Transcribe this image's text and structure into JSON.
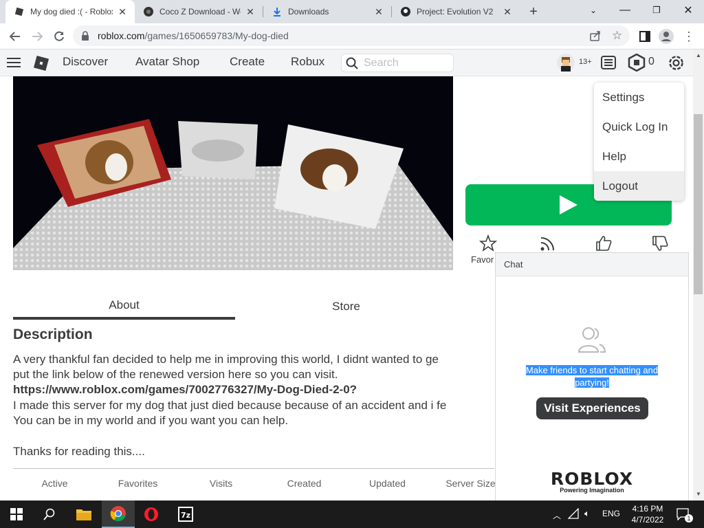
{
  "browser": {
    "tabs": [
      {
        "title": "My dog died :( - Roblox",
        "active": true
      },
      {
        "title": "Coco Z Download - Web",
        "active": false
      },
      {
        "title": "Downloads",
        "active": false
      },
      {
        "title": "Project: Evolution V2",
        "active": false
      }
    ],
    "url_host": "roblox.com",
    "url_path": "/games/1650659783/My-dog-died"
  },
  "nav": {
    "links": [
      "Discover",
      "Avatar Shop",
      "Create",
      "Robux"
    ],
    "search_placeholder": "Search",
    "age_badge": "13+",
    "robux_count": "0"
  },
  "settings_menu": {
    "items": [
      "Settings",
      "Quick Log In",
      "Help",
      "Logout"
    ],
    "hovered": "Logout"
  },
  "game": {
    "favorite_label": "Favor",
    "tabs": [
      "About",
      "Store"
    ],
    "active_tab": "About",
    "description_title": "Description",
    "description_lines": [
      "A very thankful fan decided to help me in improving this world, I didnt wanted to ge",
      "put the link below of the renewed version here so you can visit.",
      "https://www.roblox.com/games/7002776327/My-Dog-Died-2-0?",
      "I made this server for my dog that just died because because of an accident and i fe",
      "You can be in my world and if you want you can help.",
      "Thanks for reading this...."
    ],
    "stats_labels": [
      "Active",
      "Favorites",
      "Visits",
      "Created",
      "Updated",
      "Server Size"
    ]
  },
  "chat": {
    "header": "Chat",
    "empty_message": "Make friends to start chatting and partying!",
    "visit_button": "Visit Experiences",
    "logo": "ROBLOX",
    "tagline": "Powering Imagination"
  },
  "taskbar": {
    "language": "ENG",
    "time": "4:16 PM",
    "date": "4/7/2022",
    "notification_count": "1"
  }
}
